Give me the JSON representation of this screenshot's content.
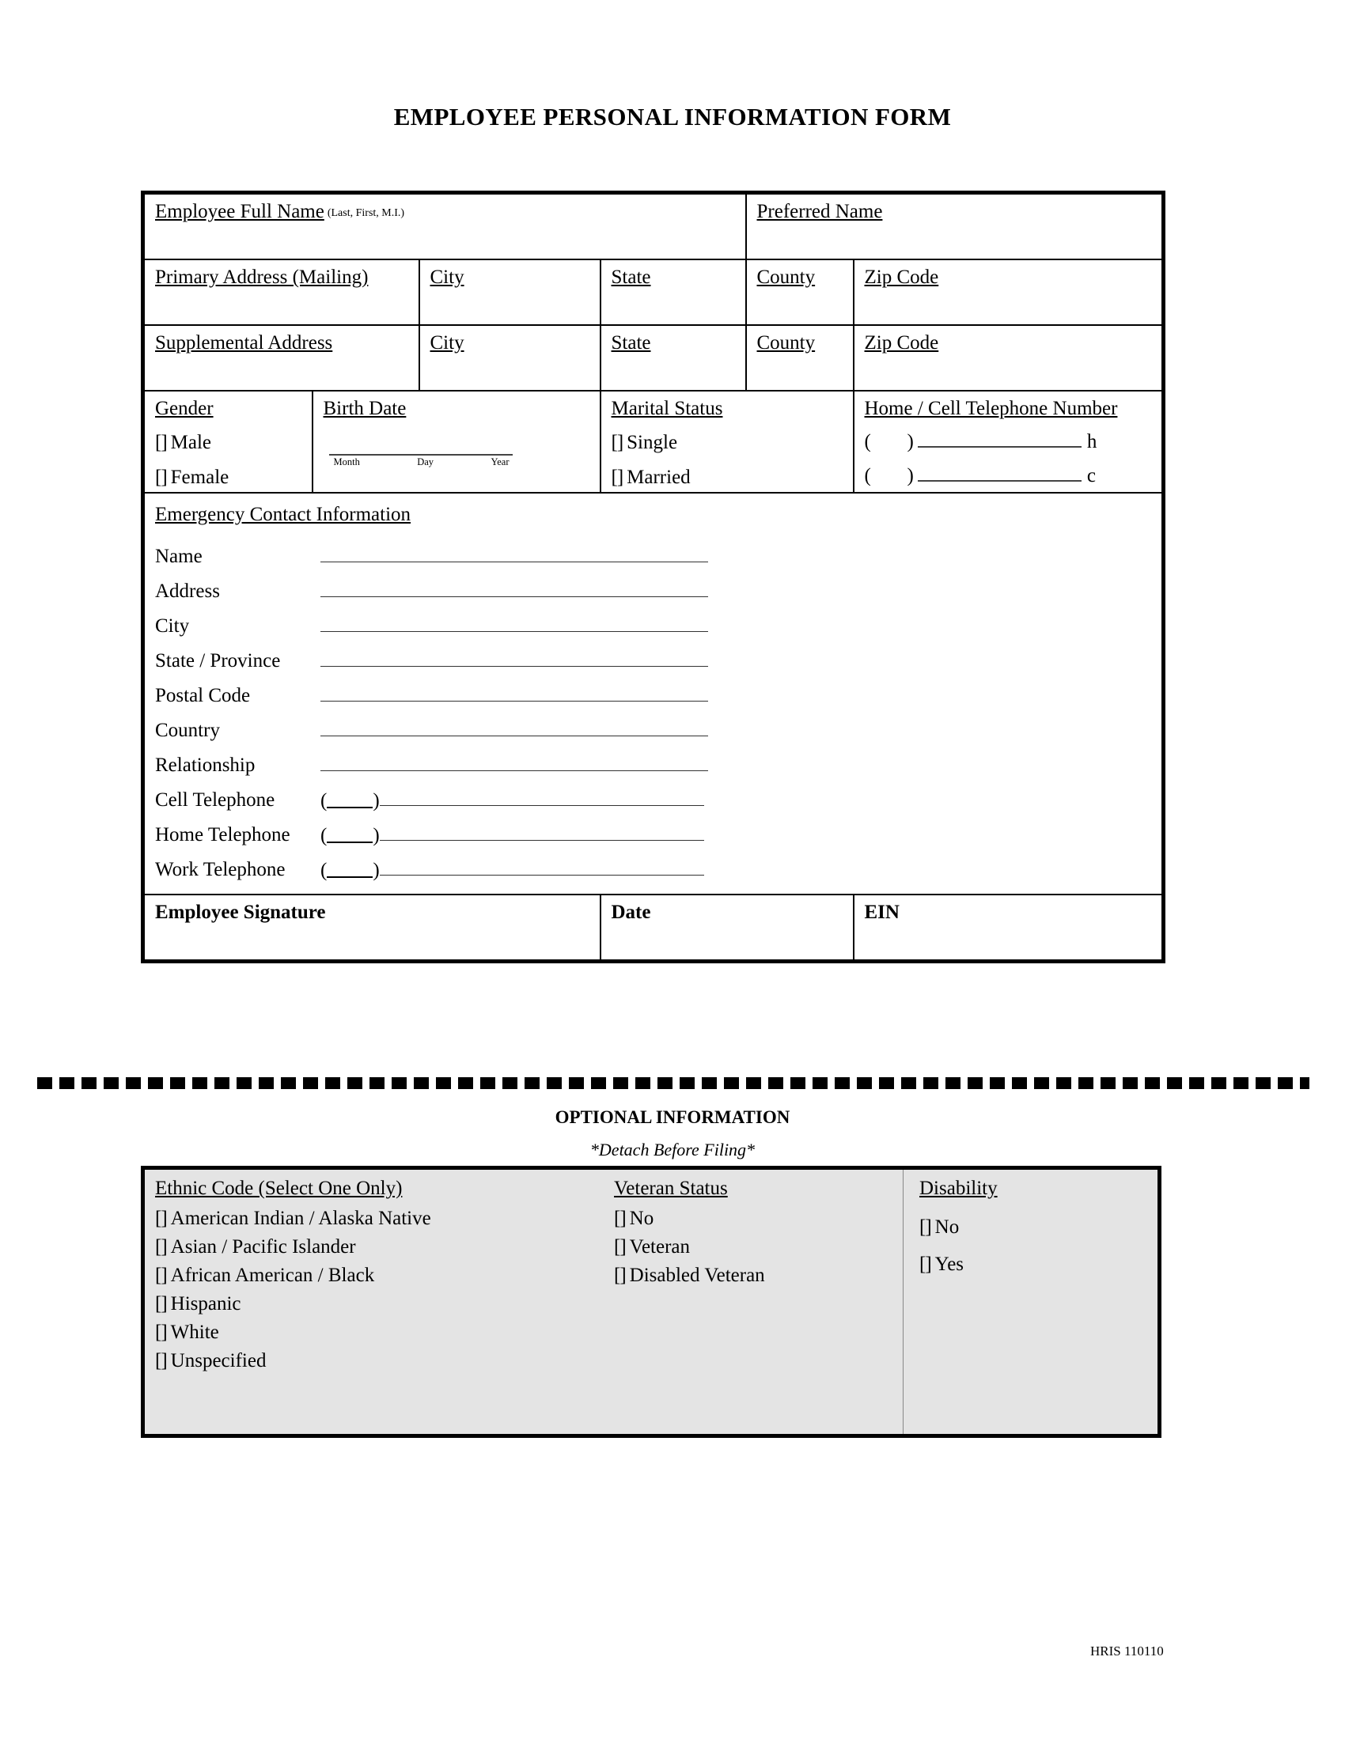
{
  "document": {
    "title": "EMPLOYEE PERSONAL INFORMATION FORM",
    "footer_code": "HRIS 110110"
  },
  "identity_row": {
    "full_name_label": "Employee Full Name",
    "full_name_note": "(Last, First, M.I.)",
    "preferred_name_label": "Preferred Name"
  },
  "address_rows": [
    {
      "address_label": "Primary Address (Mailing)",
      "city_label": "City",
      "state_label": "State",
      "county_label": "County",
      "zip_label": "Zip Code"
    },
    {
      "address_label": "Supplemental Address",
      "city_label": "City",
      "state_label": "State",
      "county_label": "County",
      "zip_label": "Zip Code"
    }
  ],
  "demographics": {
    "gender": {
      "label": "Gender",
      "options": [
        "Male",
        "Female"
      ]
    },
    "birth_date": {
      "label": "Birth Date",
      "parts": [
        "Month",
        "Day",
        "Year"
      ]
    },
    "marital_status": {
      "label": "Marital Status",
      "options": [
        "Single",
        "Married"
      ]
    },
    "telephone": {
      "label": "Home / Cell Telephone Number",
      "rows": [
        {
          "suffix": "h"
        },
        {
          "suffix": "c"
        }
      ]
    }
  },
  "emergency_contact": {
    "heading": "Emergency Contact Information ",
    "fields": [
      "Name",
      "Address",
      "City",
      "State / Province",
      "Postal Code",
      "Country",
      "Relationship"
    ],
    "phone_fields": [
      "Cell Telephone",
      "Home Telephone",
      "Work Telephone"
    ]
  },
  "signature_row": {
    "signature_label": "Employee Signature",
    "date_label": "Date",
    "ein_label": "EIN"
  },
  "optional": {
    "title": "OPTIONAL INFORMATION",
    "subtitle": "*Detach Before Filing*",
    "ethnic": {
      "heading": "Ethnic Code (Select One Only)",
      "options": [
        "American Indian / Alaska Native",
        "Asian / Pacific Islander",
        "African American / Black",
        "Hispanic",
        "White",
        "Unspecified"
      ]
    },
    "veteran": {
      "heading": "Veteran Status ",
      "options": [
        "No",
        "Veteran",
        "Disabled Veteran"
      ]
    },
    "disability": {
      "heading": "Disability",
      "options": [
        "No",
        "Yes"
      ]
    }
  },
  "glyphs": {
    "checkbox": "[]",
    "paren_open": "(",
    "paren_close": ")"
  }
}
